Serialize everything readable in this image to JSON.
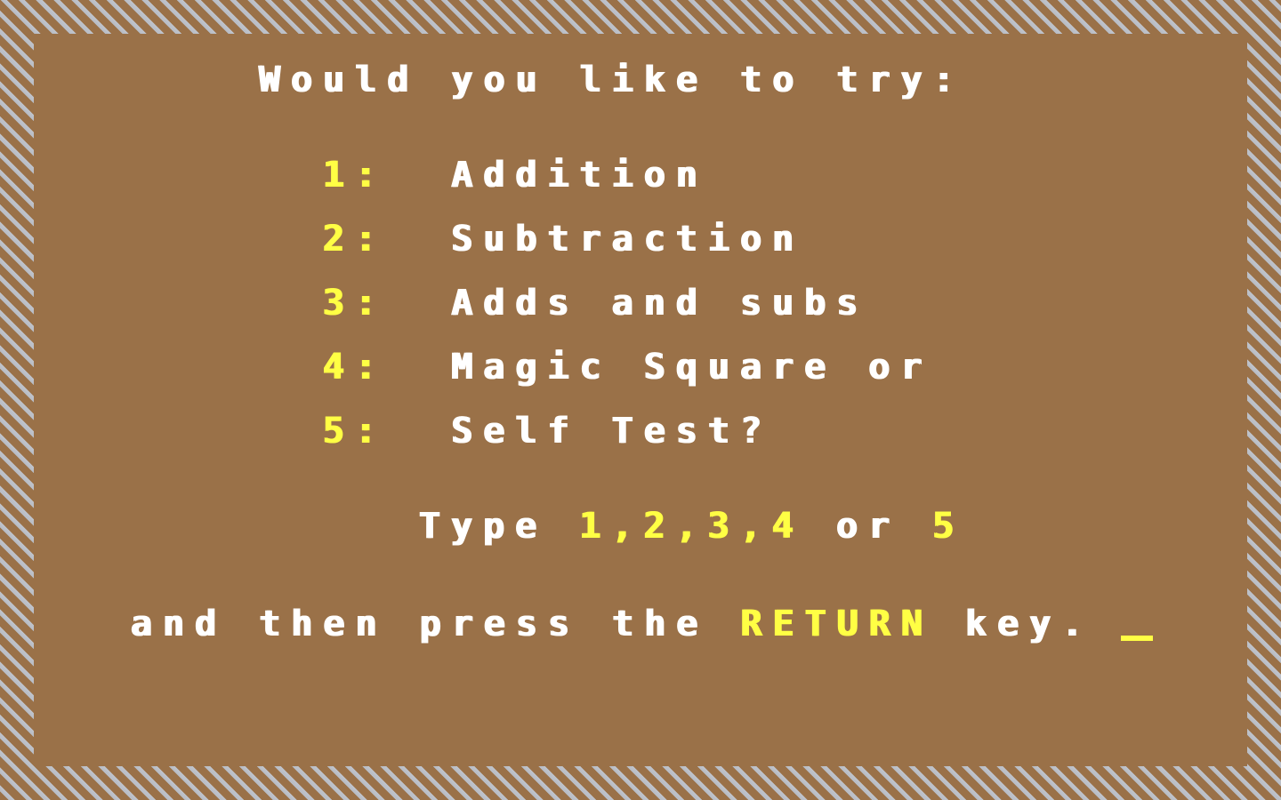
{
  "screen": {
    "prompt": "Would you like to try:",
    "options": [
      {
        "key": "1:",
        "label": "Addition"
      },
      {
        "key": "2:",
        "label": "Subtraction"
      },
      {
        "key": "3:",
        "label": "Adds and subs"
      },
      {
        "key": "4:",
        "label": "Magic Square or"
      },
      {
        "key": "5:",
        "label": "Self Test?"
      }
    ],
    "type_line": {
      "prefix": "Type ",
      "choices": "1,2,3,4",
      "middle": " or ",
      "last": "5"
    },
    "return_line": {
      "prefix": "and then press the ",
      "key": "RETURN",
      "suffix": " key."
    },
    "colors": {
      "background": "#9a7148",
      "text": "#ffffff",
      "highlight": "#ffff44",
      "border_stripe": "#c0c4cc"
    }
  }
}
